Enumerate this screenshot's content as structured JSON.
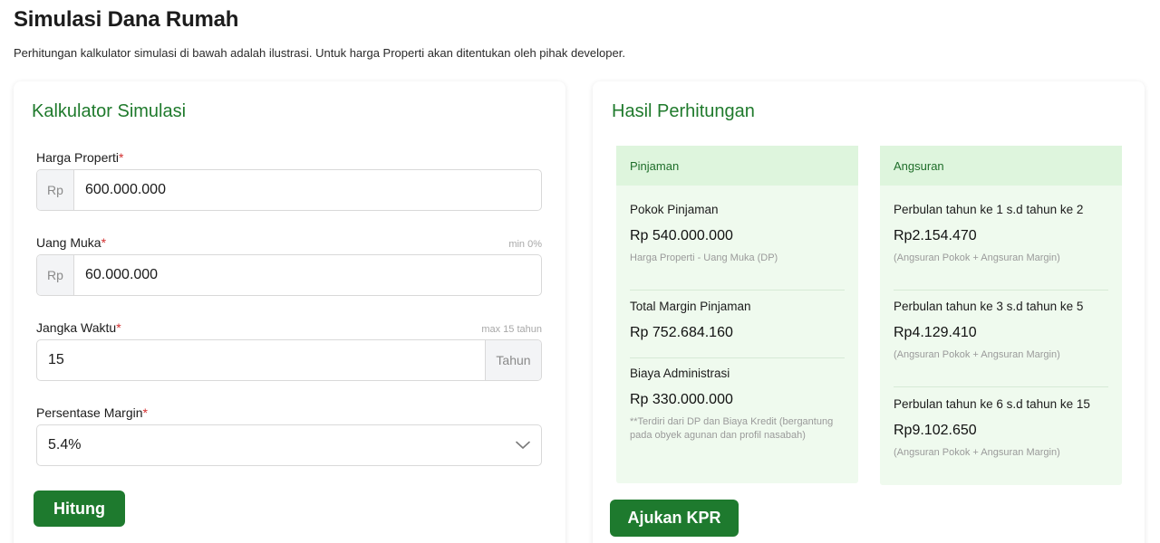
{
  "page": {
    "title": "Simulasi Dana Rumah",
    "description": "Perhitungan kalkulator simulasi di bawah adalah ilustrasi. Untuk harga Properti akan ditentukan oleh pihak developer."
  },
  "calculator": {
    "title": "Kalkulator Simulasi",
    "harga": {
      "label": "Harga Properti",
      "required": "*",
      "prefix": "Rp",
      "value": "600.000.000"
    },
    "uang_muka": {
      "label": "Uang Muka",
      "required": "*",
      "hint": "min 0%",
      "prefix": "Rp",
      "value": "60.000.000"
    },
    "jangka": {
      "label": "Jangka Waktu",
      "required": "*",
      "hint": "max 15 tahun",
      "value": "15",
      "suffix": "Tahun"
    },
    "margin": {
      "label": "Persentase Margin",
      "required": "*",
      "value": "5.4%"
    },
    "submit_label": "Hitung"
  },
  "result": {
    "title": "Hasil Perhitungan",
    "pinjaman": {
      "header": "Pinjaman",
      "items": [
        {
          "label": "Pokok Pinjaman",
          "value": "Rp 540.000.000",
          "note": "Harga Properti - Uang Muka (DP)"
        },
        {
          "label": "Total Margin Pinjaman",
          "value": "Rp 752.684.160"
        },
        {
          "label": "Biaya Administrasi",
          "value": "Rp 330.000.000",
          "note": "**Terdiri dari DP dan Biaya Kredit (bergantung pada obyek agunan dan profil nasabah)"
        }
      ]
    },
    "angsuran": {
      "header": "Angsuran",
      "items": [
        {
          "label": "Perbulan tahun ke 1 s.d tahun ke 2",
          "value": "Rp2.154.470",
          "note": "(Angsuran Pokok + Angsuran Margin)"
        },
        {
          "label": "Perbulan tahun ke 3 s.d tahun ke 5",
          "value": "Rp4.129.410",
          "note": "(Angsuran Pokok + Angsuran Margin)"
        },
        {
          "label": "Perbulan tahun ke 6 s.d tahun ke 15",
          "value": "Rp9.102.650",
          "note": "(Angsuran Pokok + Angsuran Margin)"
        }
      ]
    },
    "submit_label": "Ajukan KPR"
  },
  "colors": {
    "accent": "#1e7a2e",
    "result_bg": "#effaee",
    "result_head_bg": "#def5dd",
    "required": "#d32f2f"
  },
  "icons": {
    "select": "chevron-down-icon"
  }
}
